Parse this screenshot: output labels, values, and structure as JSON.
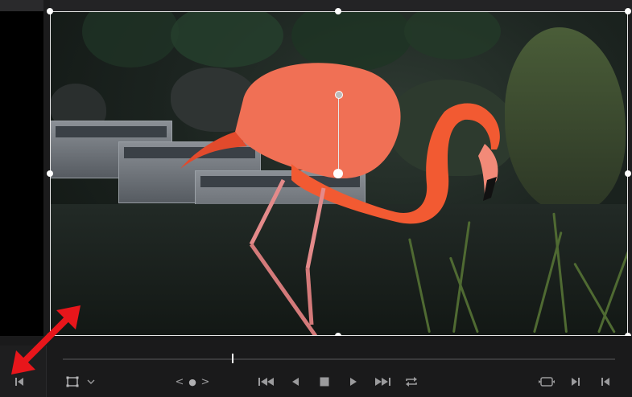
{
  "viewer": {
    "image_subject": "flamingo-photo"
  },
  "transport": {
    "nav_left_symbol": "<",
    "nav_dot_symbol": "●",
    "nav_right_symbol": ">"
  },
  "colors": {
    "accent_annotation": "#e8161b",
    "transform_box": "#e6e6e6",
    "flamingo": "#f05a3a",
    "background": "#1e1e1f"
  },
  "icons": [
    "go-to-first-frame-icon",
    "transform-mode-icon",
    "chevron-down-icon",
    "jump-to-start-icon",
    "step-back-icon",
    "stop-icon",
    "play-icon",
    "jump-to-end-icon",
    "loop-icon",
    "match-frame-icon",
    "next-clip-icon",
    "previous-clip-icon"
  ]
}
